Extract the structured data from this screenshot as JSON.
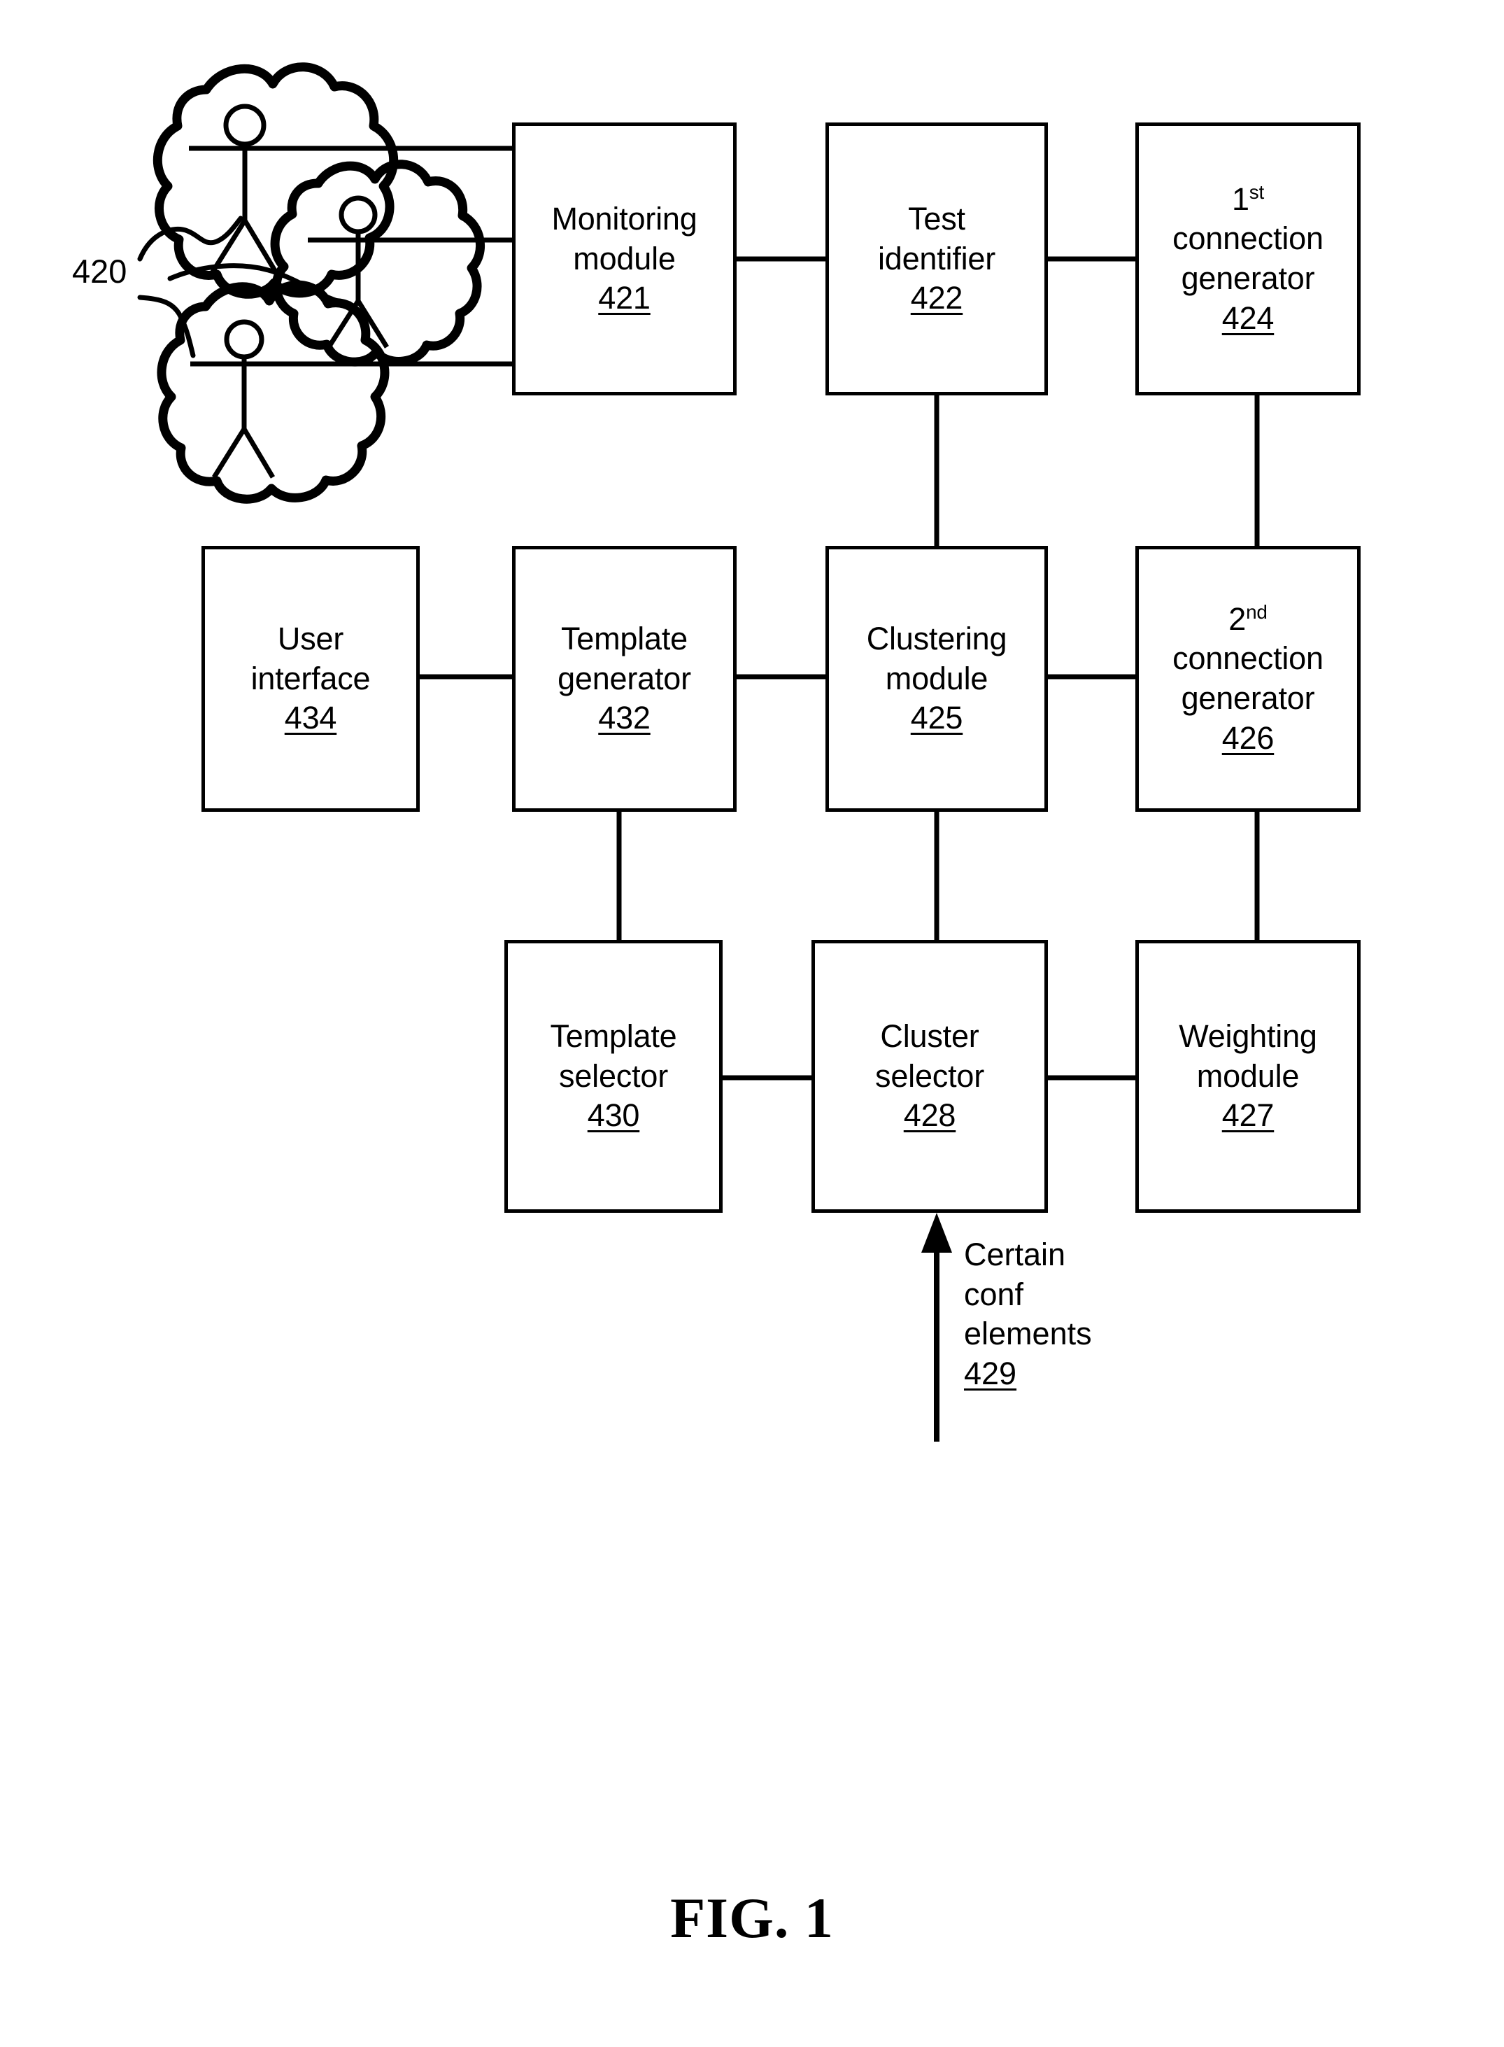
{
  "figure": {
    "caption": "FIG. 1",
    "source_label": "420"
  },
  "blocks": [
    {
      "id": "monitoring-module",
      "lines": [
        "Monitoring",
        "module"
      ],
      "ref": "421"
    },
    {
      "id": "test-identifier",
      "lines": [
        "Test",
        "identifier"
      ],
      "ref": "422"
    },
    {
      "id": "first-connection-generator",
      "ordinal_number": "1",
      "ordinal_suffix": "st",
      "lines": [
        "connection",
        "generator"
      ],
      "ref": "424"
    },
    {
      "id": "user-interface",
      "lines": [
        "User",
        "interface"
      ],
      "ref": "434"
    },
    {
      "id": "template-generator",
      "lines": [
        "Template",
        "generator"
      ],
      "ref": "432"
    },
    {
      "id": "clustering-module",
      "lines": [
        "Clustering",
        "module"
      ],
      "ref": "425"
    },
    {
      "id": "second-connection-generator",
      "ordinal_number": "2",
      "ordinal_suffix": "nd",
      "lines": [
        "connection",
        "generator"
      ],
      "ref": "426"
    },
    {
      "id": "template-selector",
      "lines": [
        "Template",
        "selector"
      ],
      "ref": "430"
    },
    {
      "id": "cluster-selector",
      "lines": [
        "Cluster",
        "selector"
      ],
      "ref": "428"
    },
    {
      "id": "weighting-module",
      "lines": [
        "Weighting",
        "module"
      ],
      "ref": "427"
    }
  ],
  "annotations": {
    "conf_elements": {
      "lines": [
        "Certain",
        "conf",
        "elements"
      ],
      "ref": "429"
    }
  },
  "chart_data": {
    "type": "diagram",
    "title": "FIG. 1",
    "nodes": [
      {
        "ref": "420",
        "label": "users / sources",
        "shape": "cloud-group",
        "count": 3
      },
      {
        "ref": "421",
        "label": "Monitoring module",
        "shape": "box"
      },
      {
        "ref": "422",
        "label": "Test identifier",
        "shape": "box"
      },
      {
        "ref": "424",
        "label": "1st connection generator",
        "shape": "box"
      },
      {
        "ref": "425",
        "label": "Clustering module",
        "shape": "box"
      },
      {
        "ref": "426",
        "label": "2nd connection generator",
        "shape": "box"
      },
      {
        "ref": "427",
        "label": "Weighting module",
        "shape": "box"
      },
      {
        "ref": "428",
        "label": "Cluster selector",
        "shape": "box"
      },
      {
        "ref": "429",
        "label": "Certain conf elements",
        "shape": "arrow-input"
      },
      {
        "ref": "430",
        "label": "Template selector",
        "shape": "box"
      },
      {
        "ref": "432",
        "label": "Template generator",
        "shape": "box"
      },
      {
        "ref": "434",
        "label": "User interface",
        "shape": "box"
      }
    ],
    "edges": [
      {
        "from": "420",
        "to": "421",
        "style": "line"
      },
      {
        "from": "421",
        "to": "422",
        "style": "line"
      },
      {
        "from": "422",
        "to": "424",
        "style": "line"
      },
      {
        "from": "422",
        "to": "425",
        "style": "line"
      },
      {
        "from": "424",
        "to": "426",
        "style": "line"
      },
      {
        "from": "425",
        "to": "426",
        "style": "line"
      },
      {
        "from": "425",
        "to": "432",
        "style": "line"
      },
      {
        "from": "432",
        "to": "434",
        "style": "line"
      },
      {
        "from": "425",
        "to": "428",
        "style": "line"
      },
      {
        "from": "426",
        "to": "427",
        "style": "line"
      },
      {
        "from": "427",
        "to": "428",
        "style": "line"
      },
      {
        "from": "428",
        "to": "430",
        "style": "line"
      },
      {
        "from": "430",
        "to": "432",
        "style": "line"
      },
      {
        "from": "429",
        "to": "428",
        "style": "arrow"
      }
    ]
  }
}
